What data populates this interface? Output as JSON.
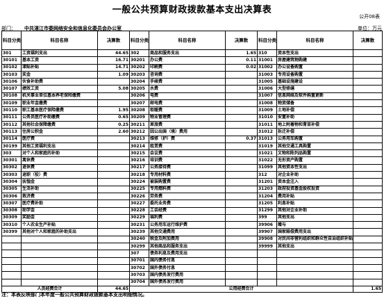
{
  "title": "一般公共预算财政拨款基本支出决算表",
  "form_code": "公开08表",
  "org_label": "部门：",
  "org_name": "中共湛江市委网络安全和信息化委员会办公室",
  "unit": "单位：万元",
  "headers": {
    "code": "科目分类科目编码",
    "name": "科目名称",
    "amount": "决算数"
  },
  "rows": [
    [
      [
        "301",
        "工资福利支出",
        "44.65"
      ],
      [
        "302",
        "商品和服务支出",
        "1.65"
      ],
      [
        "310",
        "资本性支出",
        ""
      ]
    ],
    [
      [
        "30101",
        "基本工资",
        "16.71"
      ],
      [
        "30201",
        "办公费",
        "0.11"
      ],
      [
        "31001",
        "房屋建筑物购建",
        ""
      ]
    ],
    [
      [
        "30102",
        "津贴补贴",
        "14.71"
      ],
      [
        "30202",
        "印刷费",
        "0.02"
      ],
      [
        "31002",
        "办公设备购置",
        ""
      ]
    ],
    [
      [
        "30103",
        "奖金",
        "1.09"
      ],
      [
        "30203",
        "咨询费",
        ""
      ],
      [
        "31003",
        "专用设备购置",
        ""
      ]
    ],
    [
      [
        "30106",
        "伙食补助费",
        ""
      ],
      [
        "30204",
        "手续费",
        ""
      ],
      [
        "31005",
        "基础设施建设",
        ""
      ]
    ],
    [
      [
        "30107",
        "绩效工资",
        "5.08"
      ],
      [
        "30205",
        "水费",
        ""
      ],
      [
        "31006",
        "大型修缮",
        ""
      ]
    ],
    [
      [
        "30108",
        "机关事业单位基本养老保险缴费",
        ""
      ],
      [
        "30206",
        "电费",
        ""
      ],
      [
        "31007",
        "信息网络及软件购置更新",
        ""
      ]
    ],
    [
      [
        "30109",
        "职业年金缴费",
        ""
      ],
      [
        "30207",
        "邮电费",
        ""
      ],
      [
        "31008",
        "物资储备",
        ""
      ]
    ],
    [
      [
        "30110",
        "职工基本医疗保险缴费",
        "1.95"
      ],
      [
        "30208",
        "取暖费",
        ""
      ],
      [
        "31009",
        "土地补偿",
        ""
      ]
    ],
    [
      [
        "30111",
        "公务员医疗补助缴费",
        "0.65"
      ],
      [
        "30209",
        "物业管理费",
        ""
      ],
      [
        "31010",
        "安置补助",
        ""
      ]
    ],
    [
      [
        "30112",
        "其他社会保障缴费",
        "0.25"
      ],
      [
        "30211",
        "差旅费",
        ""
      ],
      [
        "31011",
        "地上附着物和青苗补偿",
        ""
      ]
    ],
    [
      [
        "30113",
        "住房公积金",
        "2.60"
      ],
      [
        "30212",
        "因公出国（境）费用",
        ""
      ],
      [
        "31012",
        "拆迁补偿",
        ""
      ]
    ],
    [
      [
        "30114",
        "医疗费",
        ""
      ],
      [
        "30213",
        "维修（护）费",
        "0.37"
      ],
      [
        "31013",
        "公务用车购置",
        ""
      ]
    ],
    [
      [
        "30199",
        "其他工资福利支出",
        ""
      ],
      [
        "30214",
        "租赁费",
        ""
      ],
      [
        "31019",
        "其他交通工具购置",
        ""
      ]
    ],
    [
      [
        "303",
        "对个人和家庭的补助",
        ""
      ],
      [
        "30215",
        "会议费",
        ""
      ],
      [
        "31021",
        "文物和陈列品购置",
        ""
      ]
    ],
    [
      [
        "30301",
        "离休费",
        ""
      ],
      [
        "30216",
        "培训费",
        ""
      ],
      [
        "31022",
        "无形资产购置",
        ""
      ]
    ],
    [
      [
        "30302",
        "退休费",
        ""
      ],
      [
        "30217",
        "公务接待费",
        ""
      ],
      [
        "31099",
        "其他资本性支出",
        ""
      ]
    ],
    [
      [
        "30303",
        "退职（役）费",
        ""
      ],
      [
        "30218",
        "专用材料费",
        ""
      ],
      [
        "312",
        "对企业补助",
        ""
      ]
    ],
    [
      [
        "30304",
        "抚恤金",
        ""
      ],
      [
        "30224",
        "被装购置费",
        ""
      ],
      [
        "31201",
        "资本金注入",
        ""
      ]
    ],
    [
      [
        "30305",
        "生活补助",
        ""
      ],
      [
        "30225",
        "专用燃料费",
        ""
      ],
      [
        "31203",
        "政府投资基金股权投资",
        ""
      ]
    ],
    [
      [
        "30306",
        "救济费",
        ""
      ],
      [
        "30226",
        "劳务费",
        ""
      ],
      [
        "31204",
        "费用补贴",
        ""
      ]
    ],
    [
      [
        "30307",
        "医疗费补助",
        ""
      ],
      [
        "30227",
        "委托业务费",
        ""
      ],
      [
        "31205",
        "利息补贴",
        ""
      ]
    ],
    [
      [
        "30308",
        "助学金",
        ""
      ],
      [
        "30228",
        "工会经费",
        ""
      ],
      [
        "31299",
        "其他对企业补助",
        ""
      ]
    ],
    [
      [
        "30309",
        "奖励金",
        ""
      ],
      [
        "30229",
        "福利费",
        ""
      ],
      [
        "399",
        "其他支出",
        ""
      ]
    ],
    [
      [
        "30310",
        "个人农业生产补贴",
        ""
      ],
      [
        "30231",
        "公务用车运行维护费",
        ""
      ],
      [
        "39906",
        "赠与",
        ""
      ]
    ],
    [
      [
        "30399",
        "其他对个人和家庭的补助支出",
        ""
      ],
      [
        "30239",
        "其他交通费用",
        ""
      ],
      [
        "39907",
        "国家赔偿费用支出",
        ""
      ]
    ],
    [
      [
        "",
        "",
        ""
      ],
      [
        "30240",
        "税金及附加费用",
        ""
      ],
      [
        "39908",
        "对民间非营利组织和群众性自治组织补贴",
        ""
      ]
    ],
    [
      [
        "",
        "",
        ""
      ],
      [
        "30299",
        "其他商品和服务支出",
        ""
      ],
      [
        "39999",
        "其他支出",
        ""
      ]
    ],
    [
      [
        "",
        "",
        ""
      ],
      [
        "307",
        "债务利息及费用支出",
        ""
      ],
      [
        "",
        "",
        ""
      ]
    ],
    [
      [
        "",
        "",
        ""
      ],
      [
        "30701",
        "国内债务付息",
        ""
      ],
      [
        "",
        "",
        ""
      ]
    ],
    [
      [
        "",
        "",
        ""
      ],
      [
        "30702",
        "国外债务付息",
        ""
      ],
      [
        "",
        "",
        ""
      ]
    ],
    [
      [
        "",
        "",
        ""
      ],
      [
        "30703",
        "国内债务发行费用",
        ""
      ],
      [
        "",
        "",
        ""
      ]
    ],
    [
      [
        "",
        "",
        ""
      ],
      [
        "30704",
        "国外债务发行费用",
        ""
      ],
      [
        "",
        "",
        ""
      ]
    ]
  ],
  "totals": {
    "personnel_label": "人员经费合计",
    "personnel_value": "44.65",
    "public_label": "公用经费合计",
    "public_value": "1.65"
  },
  "footnote": "注：本表反映部门本年度一般公共预算财政拨款基本支出明细情况。"
}
